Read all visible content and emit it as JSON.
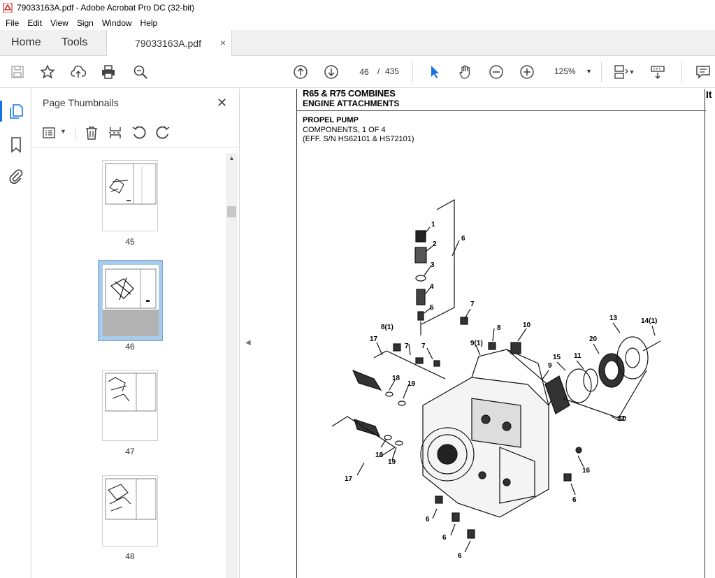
{
  "window": {
    "title": "79033163A.pdf - Adobe Acrobat Pro DC (32-bit)"
  },
  "menu": [
    "File",
    "Edit",
    "View",
    "Sign",
    "Window",
    "Help"
  ],
  "tabs": {
    "home": "Home",
    "tools": "Tools",
    "document": "79033163A.pdf",
    "close_glyph": "×"
  },
  "toolbar": {
    "page_current": "46",
    "page_sep": "/",
    "page_total": "435",
    "zoom": "125%"
  },
  "panel": {
    "title": "Page Thumbnails",
    "thumbnails": [
      {
        "page": "45",
        "selected": false
      },
      {
        "page": "46",
        "selected": true
      },
      {
        "page": "47",
        "selected": false
      },
      {
        "page": "48",
        "selected": false
      }
    ]
  },
  "document": {
    "header_line1": "R65 & R75 COMBINES",
    "header_line2": "ENGINE ATTACHMENTS",
    "section_title": "PROPEL PUMP",
    "section_sub": "COMPONENTS, 1 OF 4",
    "section_eff": "(EFF. S/N HS62101 & HS72101)",
    "right_cut_text": "It",
    "callouts": [
      "1",
      "2",
      "3",
      "4",
      "5",
      "6",
      "7",
      "8",
      "8(1)",
      "9",
      "9(1)",
      "10",
      "11",
      "12",
      "13",
      "14(1)",
      "15",
      "16",
      "17",
      "18",
      "19",
      "20"
    ]
  }
}
